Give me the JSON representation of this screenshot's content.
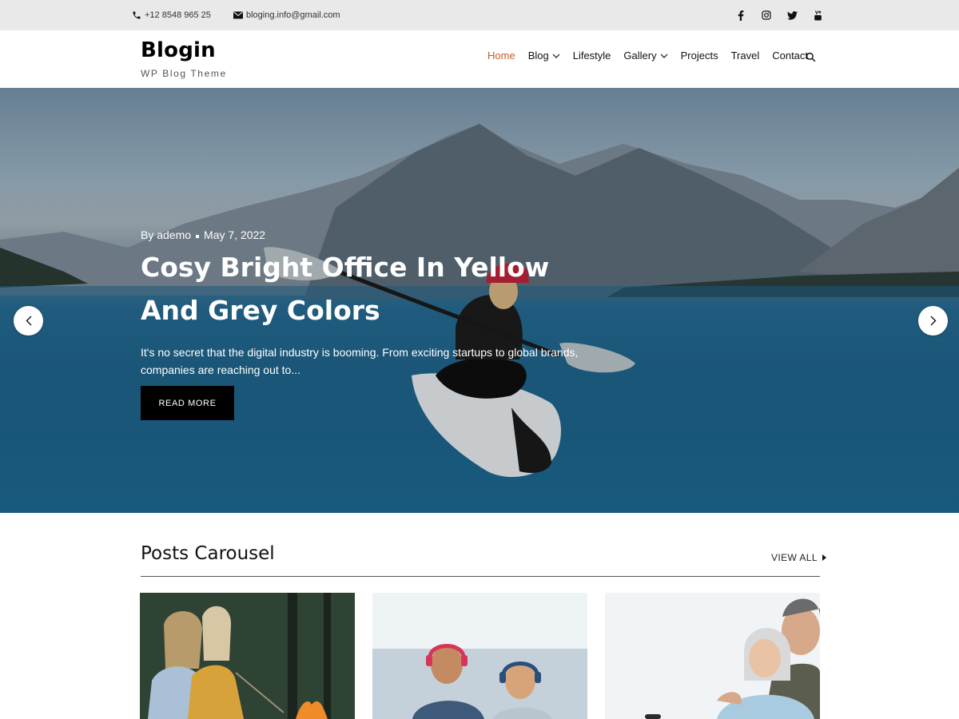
{
  "topbar": {
    "phone": "+12 8548 965 25",
    "email": "bloging.info@gmail.com",
    "social": [
      "facebook-icon",
      "instagram-icon",
      "twitter-icon",
      "youtube-icon"
    ]
  },
  "header": {
    "site_title": "Blogin",
    "tagline": "WP Blog Theme",
    "nav": [
      {
        "label": "Home",
        "active": true,
        "dropdown": false
      },
      {
        "label": "Blog",
        "active": false,
        "dropdown": true
      },
      {
        "label": "Lifestyle",
        "active": false,
        "dropdown": false
      },
      {
        "label": "Gallery",
        "active": false,
        "dropdown": true
      },
      {
        "label": "Projects",
        "active": false,
        "dropdown": false
      },
      {
        "label": "Travel",
        "active": false,
        "dropdown": false
      },
      {
        "label": "Contact",
        "active": false,
        "dropdown": false
      }
    ],
    "search_icon": "search-icon"
  },
  "hero": {
    "author": "By ademo",
    "date": "May 7, 2022",
    "title": "Cosy Bright Office In Yellow And Grey Colors",
    "excerpt": "It's no secret that the digital industry is booming. From exciting startups to global brands, companies are reaching out to...",
    "cta": "READ MORE",
    "prev_icon": "chevron-left-icon",
    "next_icon": "chevron-right-icon"
  },
  "posts_carousel": {
    "title": "Posts Carousel",
    "view_all": "VIEW ALL"
  },
  "colors": {
    "accent": "#c95b1e",
    "topbar_bg": "#e9e9e9",
    "button_bg": "#000000"
  }
}
